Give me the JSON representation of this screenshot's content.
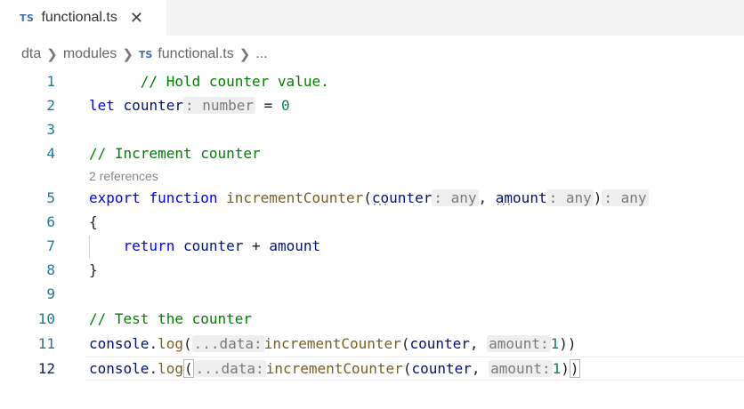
{
  "tab": {
    "icon": "TS",
    "title": "functional.ts",
    "close": "✕"
  },
  "breadcrumb": {
    "items": [
      "dta",
      "modules"
    ],
    "file_icon": "TS",
    "file": "functional.ts",
    "more": "..."
  },
  "editor": {
    "line_numbers": [
      "1",
      "2",
      "3",
      "4",
      "5",
      "6",
      "7",
      "8",
      "9",
      "10",
      "11",
      "12"
    ],
    "codelens": "2 references",
    "lines": {
      "l1": "// Hold counter value.",
      "l2_kw": "let",
      "l2_var": "counter",
      "l2_hint": ": number",
      "l2_rest": " = ",
      "l2_num": "0",
      "l4": "// Increment counter",
      "l5_kw1": "export",
      "l5_kw2": "function",
      "l5_fn": "incrementCounter",
      "l5_p1": "counter",
      "l5_h1": ": any",
      "l5_p2": "amount",
      "l5_h2": ": any",
      "l5_h3": ": any",
      "l6": "{",
      "l7_kw": "return",
      "l7_a": "counter",
      "l7_op": " + ",
      "l7_b": "amount",
      "l8": "}",
      "l10": "// Test the counter",
      "log_obj": "console",
      "log_fn": "log",
      "log_hint1": "...data:",
      "log_fn2": "incrementCounter",
      "log_arg1": "counter",
      "log_hint2": "amount:",
      "log_num": "1"
    }
  }
}
